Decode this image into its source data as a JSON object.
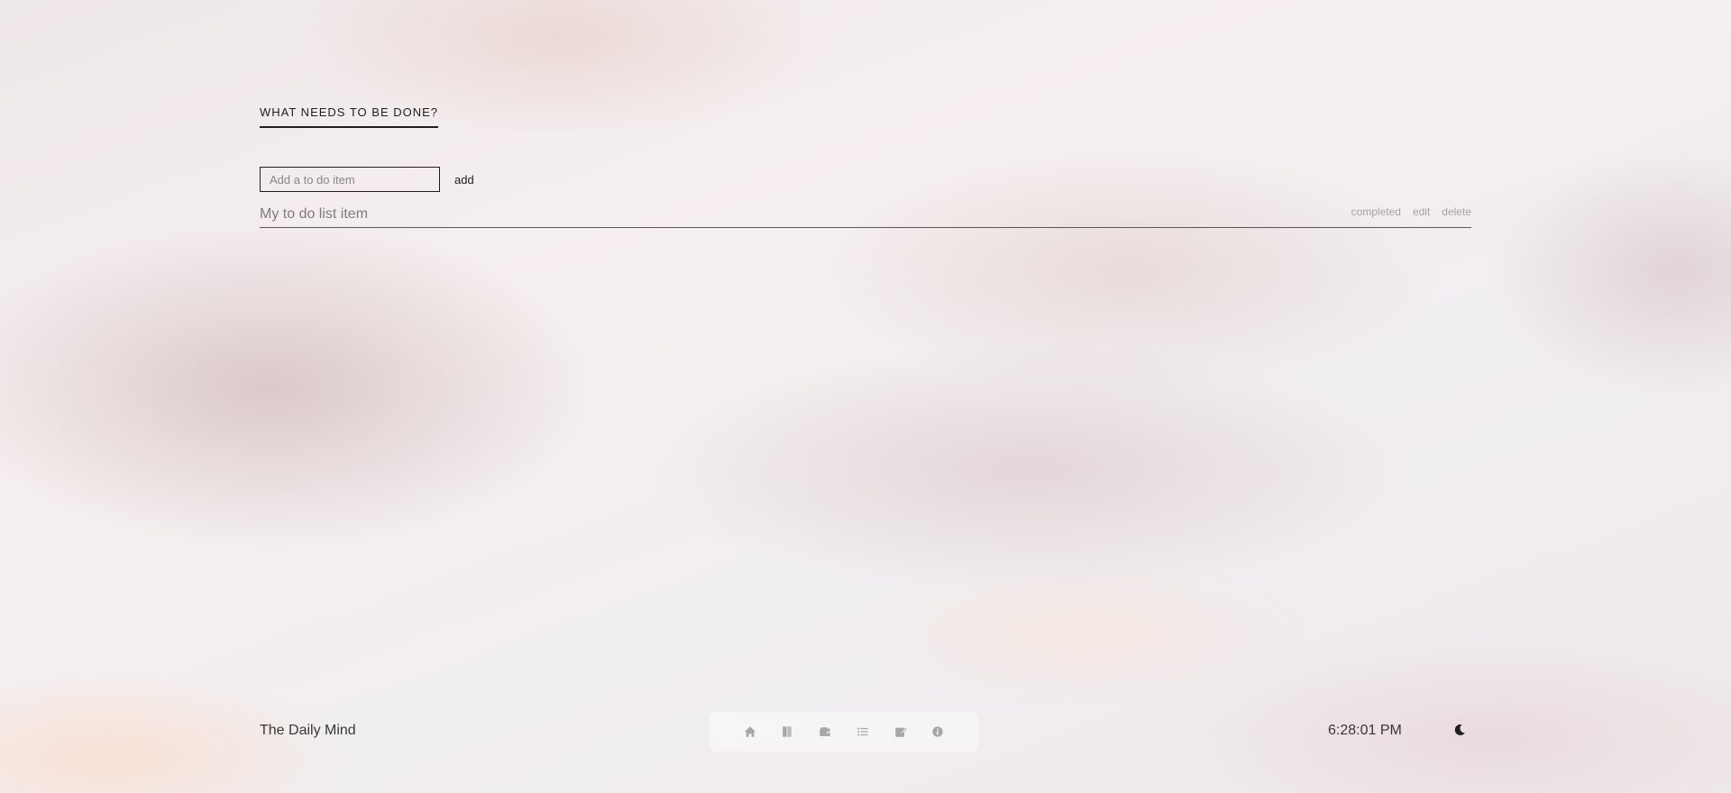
{
  "todo": {
    "heading": "WHAT NEEDS TO BE DONE?",
    "input_placeholder": "Add a to do item",
    "input_value": "",
    "add_label": "add",
    "items": [
      {
        "text": "My to do list item",
        "actions": {
          "completed": "completed",
          "edit": "edit",
          "delete": "delete"
        }
      }
    ]
  },
  "footer": {
    "brand": "The Daily Mind",
    "time": "6:28:01 PM",
    "theme_icon": "moon-icon"
  },
  "dock": {
    "icons": [
      "home-icon",
      "book-icon",
      "wallet-icon",
      "list-icon",
      "note-edit-icon",
      "info-icon"
    ],
    "icon_color": "#a9a4a6"
  },
  "colors": {
    "text_dark": "#1e1e1e",
    "text_muted": "#7f7a7c",
    "action_muted": "#a7a1a3"
  }
}
